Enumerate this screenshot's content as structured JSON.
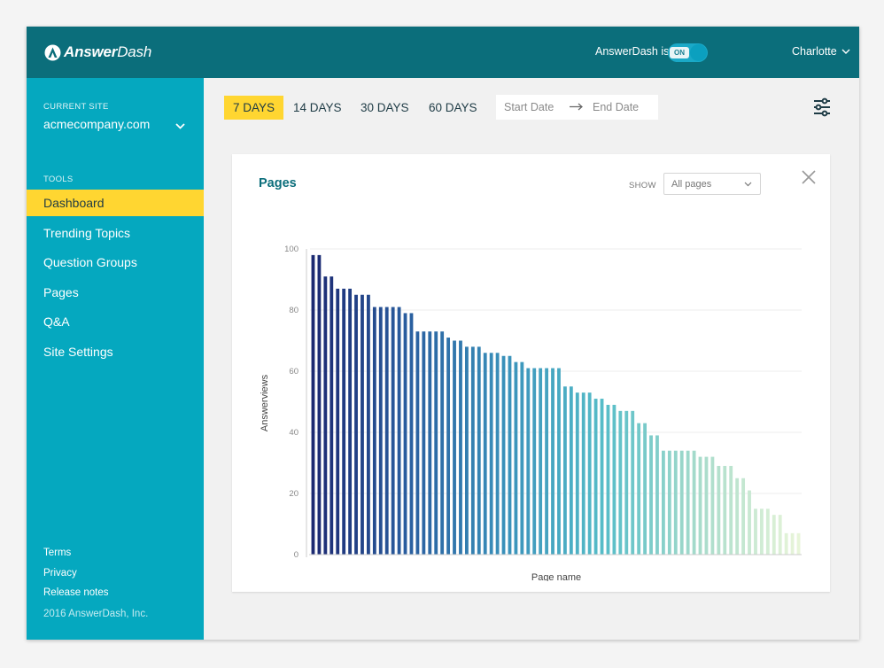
{
  "app": {
    "brand_bold": "Answer",
    "brand_rest": "Dash",
    "status_text": "AnswerDash is",
    "toggle_label": "ON",
    "user_name": "Charlotte"
  },
  "sidebar": {
    "current_site_label": "CURRENT SITE",
    "site_name": "acmecompany.com",
    "tools_label": "TOOLS",
    "items": [
      {
        "label": "Dashboard"
      },
      {
        "label": "Trending Topics"
      },
      {
        "label": "Question Groups"
      },
      {
        "label": "Pages"
      },
      {
        "label": "Q&A"
      },
      {
        "label": "Site Settings"
      }
    ],
    "footer": {
      "terms": "Terms",
      "privacy": "Privacy",
      "release_notes": "Release notes",
      "copyright": "2016 AnswerDash, Inc."
    }
  },
  "toolbar": {
    "ranges": [
      {
        "label": "7 DAYS"
      },
      {
        "label": "14 DAYS"
      },
      {
        "label": "30 DAYS"
      },
      {
        "label": "60 DAYS"
      }
    ],
    "start_date_placeholder": "Start Date",
    "end_date_placeholder": "End Date"
  },
  "card": {
    "title": "Pages",
    "show_label": "SHOW",
    "select_value": "All pages"
  },
  "colors": {
    "brand_dark": "#0b6e7b",
    "sidebar": "#05a8bf",
    "highlight": "#ffd631",
    "bar_gradient": [
      "#1c2a72",
      "#2a5fa0",
      "#3a92bb",
      "#56bdc8",
      "#a9dccb",
      "#e8f5d9"
    ]
  },
  "chart_data": {
    "type": "bar",
    "title": "",
    "xlabel": "Page name",
    "ylabel": "Answerviews",
    "ylim": [
      0,
      100
    ],
    "yticks": [
      0,
      20,
      40,
      60,
      80,
      100
    ],
    "grid": true,
    "values": [
      98,
      98,
      91,
      91,
      87,
      87,
      87,
      85,
      85,
      85,
      81,
      81,
      81,
      81,
      81,
      79,
      79,
      73,
      73,
      73,
      73,
      73,
      71,
      70,
      70,
      68,
      68,
      68,
      66,
      66,
      66,
      65,
      65,
      63,
      63,
      61,
      61,
      61,
      61,
      61,
      61,
      55,
      55,
      53,
      53,
      53,
      51,
      51,
      49,
      49,
      47,
      47,
      47,
      43,
      43,
      39,
      39,
      34,
      34,
      34,
      34,
      34,
      34,
      32,
      32,
      32,
      29,
      29,
      29,
      25,
      25,
      21,
      15,
      15,
      15,
      13,
      13,
      7,
      7,
      7
    ]
  }
}
